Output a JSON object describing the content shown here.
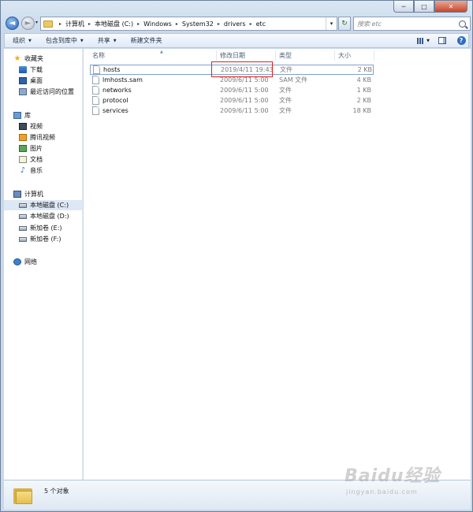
{
  "window": {
    "caption": {
      "minimize": "─",
      "maximize": "□",
      "close": "✕"
    }
  },
  "nav": {
    "back_glyph": "◄",
    "forward_glyph": "►",
    "history_glyph": "▾"
  },
  "address": {
    "crumbs": [
      "计算机",
      "本地磁盘 (C:)",
      "Windows",
      "System32",
      "drivers",
      "etc"
    ],
    "separator": "▸",
    "dropdown_glyph": "▾",
    "refresh_glyph": "↻"
  },
  "search": {
    "placeholder": "搜索 etc"
  },
  "toolbar": {
    "organize": "组织",
    "include_in_library": "包含到库中",
    "share": "共享",
    "new_folder": "新建文件夹",
    "caret": "▼",
    "help": "?"
  },
  "sidebar": {
    "favorites": "收藏夹",
    "downloads": "下载",
    "desktop": "桌面",
    "recent": "最近访问的位置",
    "libraries": "库",
    "video": "视频",
    "tencent_video": "腾讯视频",
    "pictures": "图片",
    "documents": "文档",
    "music": "音乐",
    "computer": "计算机",
    "drive_c": "本地磁盘 (C:)",
    "drive_d": "本地磁盘 (D:)",
    "drive_e": "新加卷 (E:)",
    "drive_f": "新加卷 (F:)",
    "network": "网络"
  },
  "columns": {
    "name": "名称",
    "modified": "修改日期",
    "type": "类型",
    "size": "大小",
    "sort_caret": "▲"
  },
  "files": [
    {
      "name": "hosts",
      "modified": "2019/4/11 19:43",
      "type": "文件",
      "size": "2 KB"
    },
    {
      "name": "lmhosts.sam",
      "modified": "2009/6/11 5:00",
      "type": "SAM 文件",
      "size": "4 KB"
    },
    {
      "name": "networks",
      "modified": "2009/6/11 5:00",
      "type": "文件",
      "size": "1 KB"
    },
    {
      "name": "protocol",
      "modified": "2009/6/11 5:00",
      "type": "文件",
      "size": "2 KB"
    },
    {
      "name": "services",
      "modified": "2009/6/11 5:00",
      "type": "文件",
      "size": "18 KB"
    }
  ],
  "status": {
    "count": "5 个对象"
  },
  "watermark": {
    "main": "Baidu经验",
    "sub": "jingyan.baidu.com"
  },
  "colors": {
    "highlight": "#e02020",
    "selection": "#dde8f5"
  }
}
